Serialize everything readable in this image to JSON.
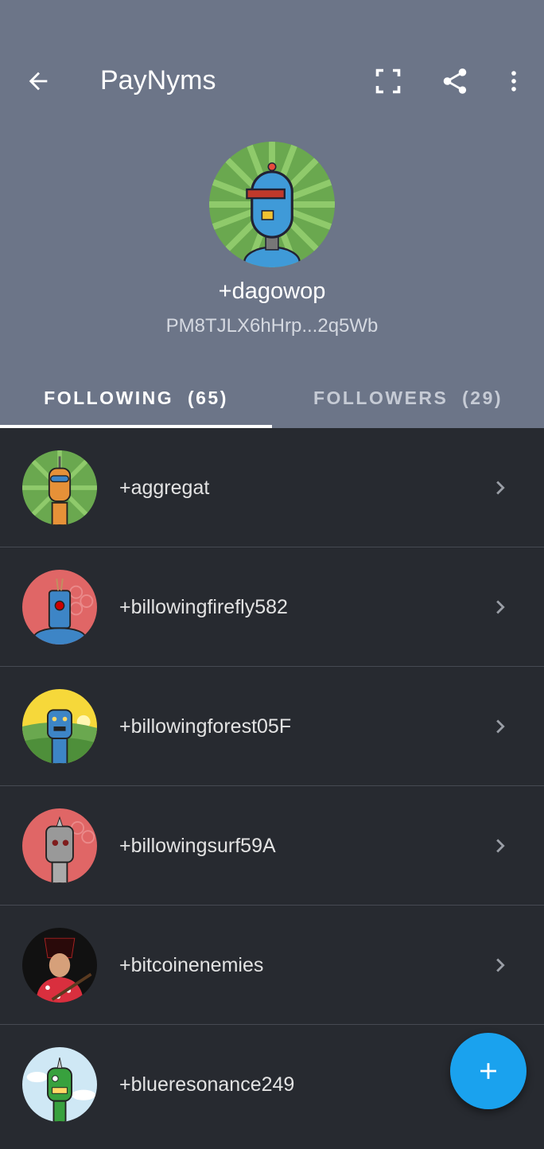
{
  "app": {
    "title": "PayNyms"
  },
  "icons": {
    "back": "arrow-back-icon",
    "scan": "scan-qr-icon",
    "share": "share-icon",
    "more": "more-vert-icon",
    "chevron": "chevron-right-icon",
    "add": "plus-icon"
  },
  "profile": {
    "name": "+dagowop",
    "code": "PM8TJLX6hHrp...2q5Wb"
  },
  "tabs": [
    {
      "label": "FOLLOWING  (65)",
      "active": true
    },
    {
      "label": "FOLLOWERS  (29)",
      "active": false
    }
  ],
  "following": [
    {
      "name": "+aggregat"
    },
    {
      "name": "+billowingfirefly582"
    },
    {
      "name": "+billowingforest05F"
    },
    {
      "name": "+billowingsurf59A"
    },
    {
      "name": "+bitcoinenemies"
    },
    {
      "name": "+blueresonance249"
    }
  ],
  "colors": {
    "header_bg": "#6c7588",
    "list_bg": "#272a30",
    "accent": "#1aa2ee",
    "divider": "#464a52"
  }
}
